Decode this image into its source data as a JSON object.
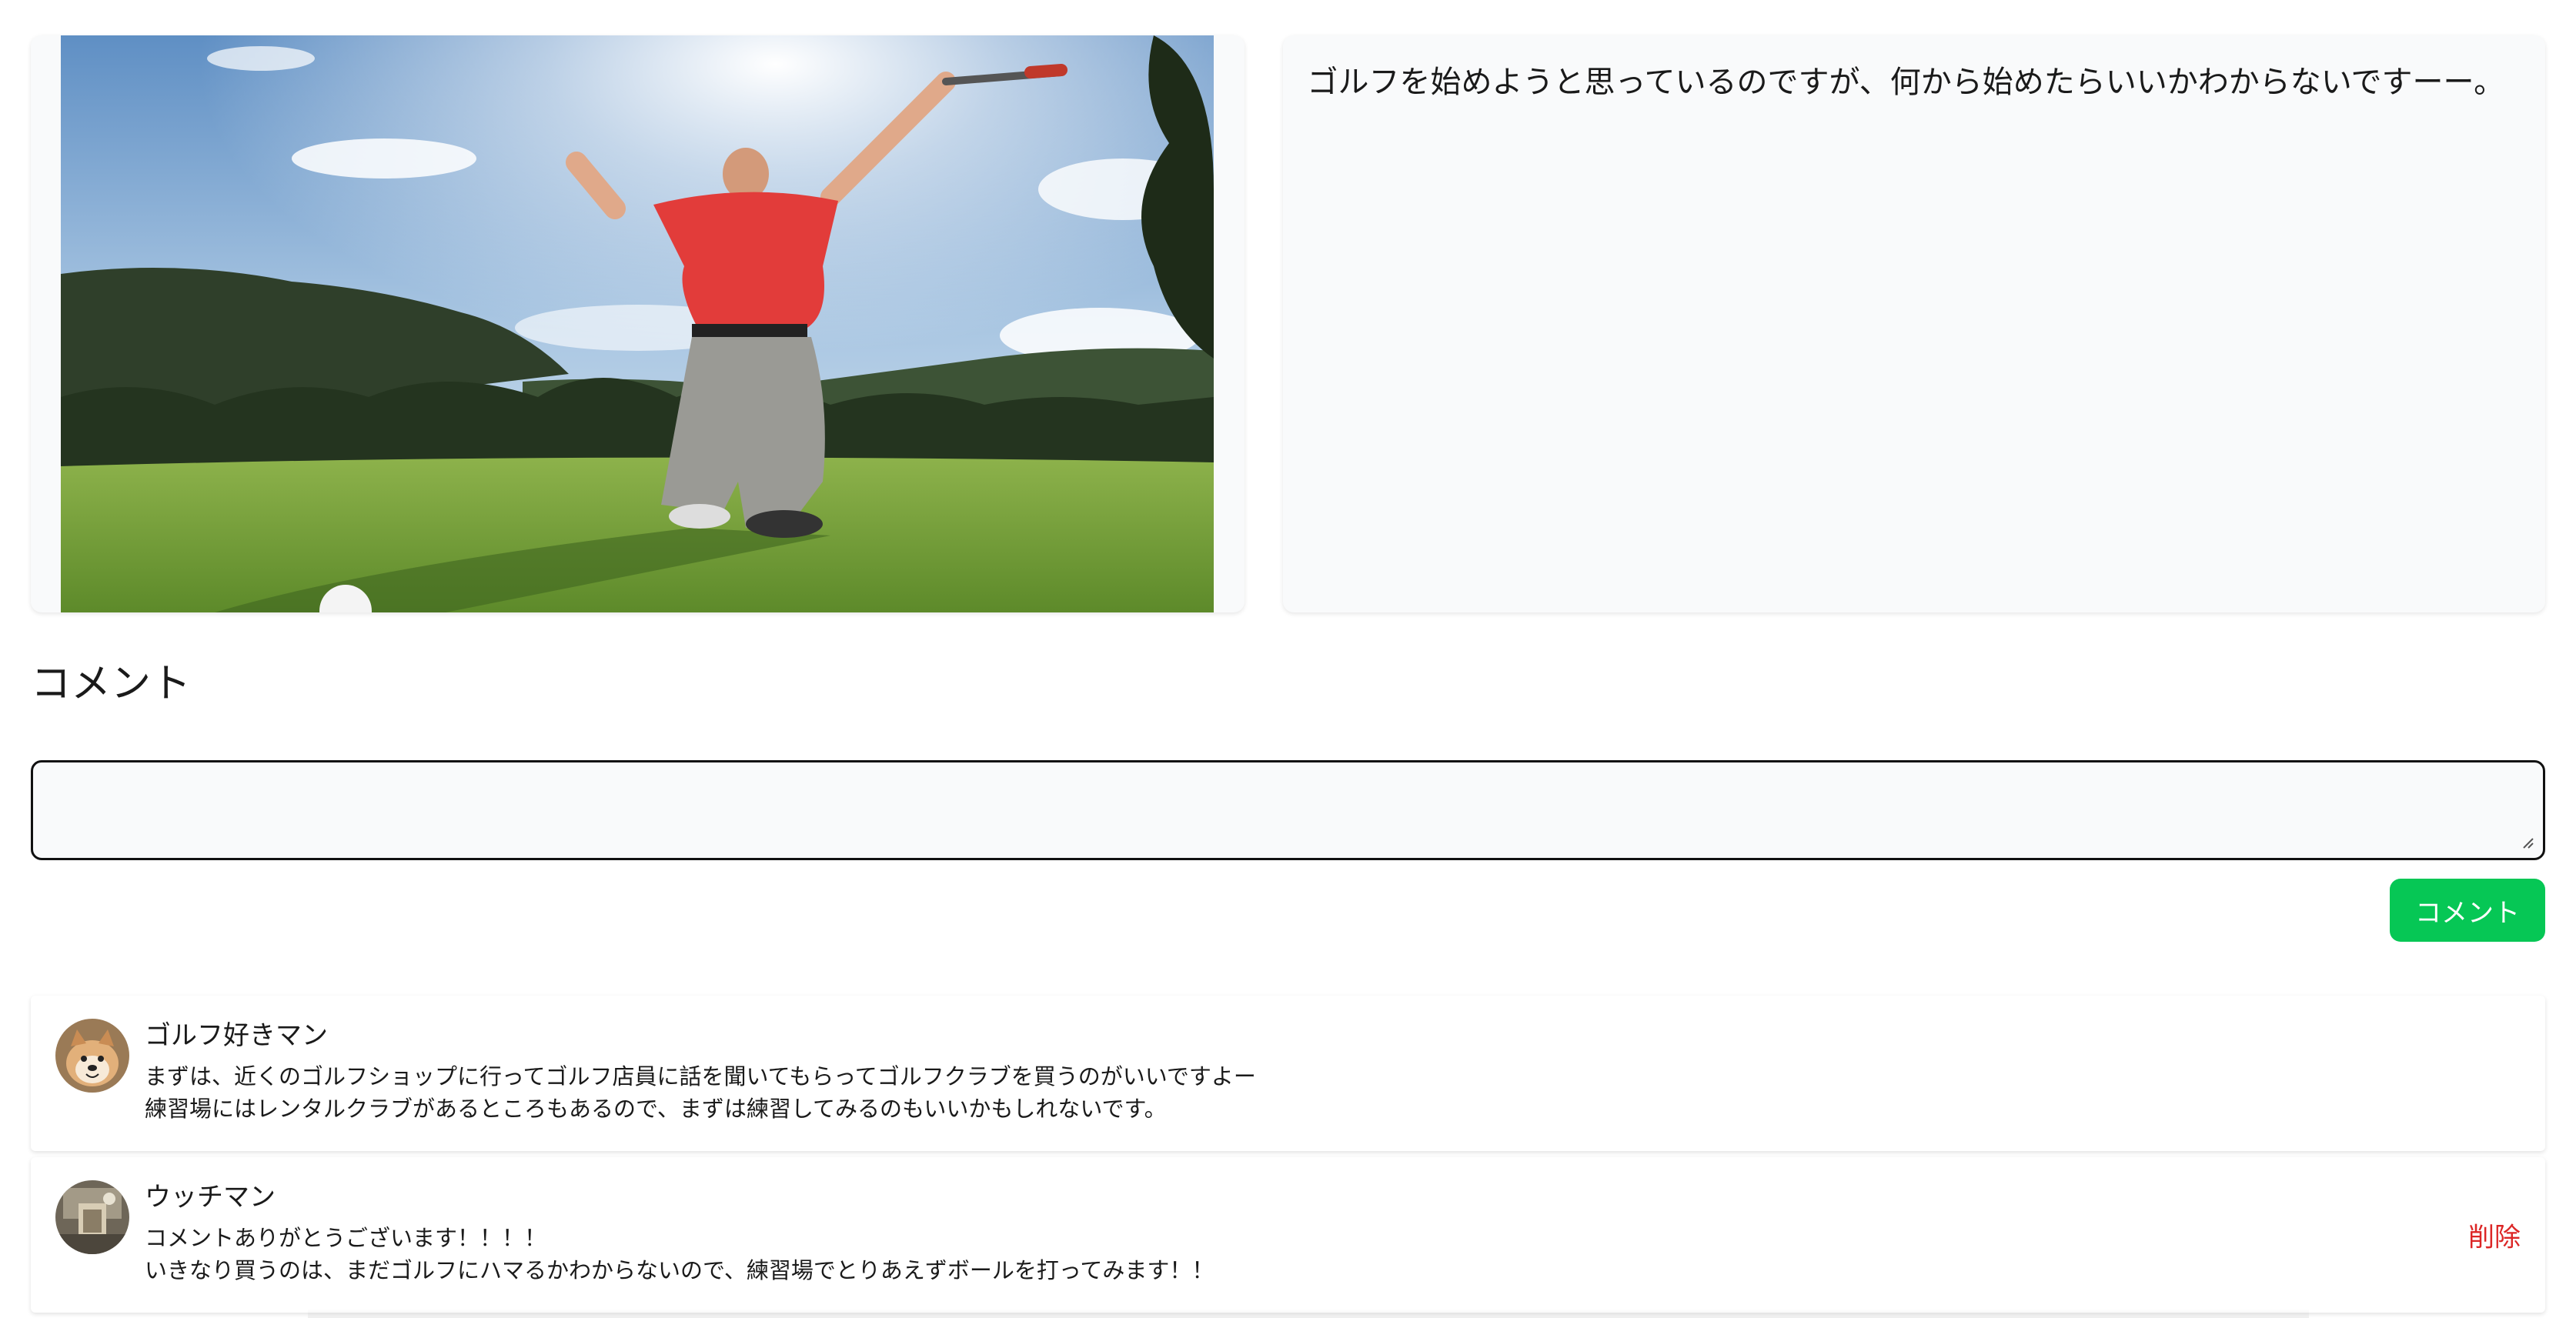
{
  "post": {
    "image_alt": "golfer celebrating on green",
    "body": "ゴルフを始めようと思っているのですが、何から始めたらいいかわからないですーー。"
  },
  "comments_section": {
    "title": "コメント",
    "input_value": "",
    "input_placeholder": "",
    "submit_label": "コメント"
  },
  "comments": [
    {
      "author": "ゴルフ好きマン",
      "avatar_icon": "shiba-dog-avatar",
      "text": "まずは、近くのゴルフショップに行ってゴルフ店員に話を聞いてもらってゴルフクラブを買うのがいいですよー\n練習場にはレンタルクラブがあるところもあるので、まずは練習してみるのもいいかもしれないです。",
      "deletable": false
    },
    {
      "author": "ウッチマン",
      "avatar_icon": "room-photo-avatar",
      "text": "コメントありがとうございます！！！！\nいきなり買うのは、まだゴルフにハマるかわからないので、練習場でとりあえずボールを打ってみます！！",
      "deletable": true,
      "delete_label": "削除"
    }
  ],
  "colors": {
    "accent_green": "#06c755",
    "delete_red": "#dc2626",
    "card_bg": "#f9fafb"
  }
}
